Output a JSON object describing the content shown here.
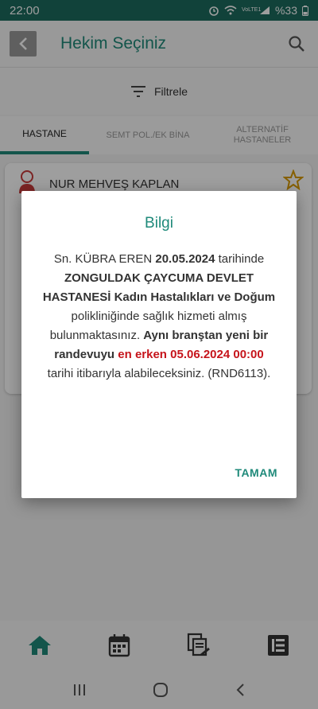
{
  "status_bar": {
    "time": "22:00",
    "battery": "%33",
    "network": "VoLTE1"
  },
  "header": {
    "title": "Hekim Seçiniz"
  },
  "filter": {
    "label": "Filtrele"
  },
  "tabs": [
    {
      "label": "HASTANE",
      "active": true
    },
    {
      "label": "SEMT POL./EK BİNA",
      "active": false
    },
    {
      "label": "ALTERNATİF HASTANELER",
      "active": false
    }
  ],
  "doctor_card": {
    "name": "NUR MEHVEŞ KAPLAN"
  },
  "dialog": {
    "title": "Bilgi",
    "msg_1": "Sn. KÜBRA EREN ",
    "msg_2": "20.05.2024",
    "msg_3": " tarihinde ",
    "msg_4": "ZONGULDAK ÇAYCUMA DEVLET HASTANESİ",
    "msg_5": " ",
    "msg_6": "Kadın Hastalıkları ve Doğum",
    "msg_7": " polikliniğinde sağlık hizmeti almış bulunmaktasınız. ",
    "msg_8": "Aynı branştan yeni bir randevuyu ",
    "msg_9": "en erken 05.06.2024 00:00",
    "msg_10": " tarihi itibarıyla alabileceksiniz. (RND6113).",
    "ok_label": "TAMAM"
  },
  "colors": {
    "primary": "#1f8a7a",
    "status_bar": "#1c6b5e",
    "highlight_red": "#c6141b",
    "overlay": "rgba(0,0,0,0.38)"
  },
  "icons": {
    "back": "arrow-left-icon",
    "search": "search-icon",
    "filter": "filter-icon",
    "favorite": "star-outline-icon",
    "home": "home-icon",
    "calendar": "calendar-icon",
    "documents": "documents-icon",
    "menu": "menu-list-icon"
  }
}
